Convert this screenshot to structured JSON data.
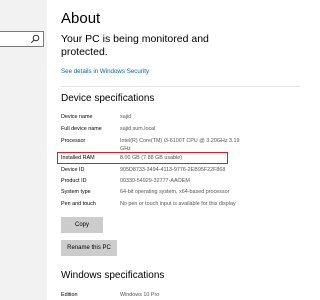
{
  "page": {
    "title": "About",
    "monitored_text": "Your PC is being monitored and protected.",
    "security_link": "See details in Windows Security"
  },
  "device_specs": {
    "heading": "Device specifications",
    "rows": [
      {
        "label": "Device name",
        "value": "sajid"
      },
      {
        "label": "Full device name",
        "value": "sajid.xum.local"
      },
      {
        "label": "Processor",
        "value": "Intel(R) Core(TM) i3-6100T CPU @ 3.20GHz   3.19 GHz"
      },
      {
        "label": "Installed RAM",
        "value": "8.00 GB (7.88 GB usable)"
      },
      {
        "label": "Device ID",
        "value": "905D8733-3494-4113-9776-2EB95F22F868"
      },
      {
        "label": "Product ID",
        "value": "00330-54929-32777-AAOEM"
      },
      {
        "label": "System type",
        "value": "64-bit operating system, x64-based processor"
      },
      {
        "label": "Pen and touch",
        "value": "No pen or touch input is available for this display"
      }
    ],
    "copy_label": "Copy",
    "rename_label": "Rename this PC"
  },
  "windows_specs": {
    "heading": "Windows specifications",
    "rows": [
      {
        "label": "Edition",
        "value": "Windows 10 Pro"
      }
    ]
  },
  "colors": {
    "link": "#0067b8",
    "highlight_border": "#d4202a",
    "button_bg": "#cccccc"
  },
  "icons": {
    "search": "search-icon"
  }
}
